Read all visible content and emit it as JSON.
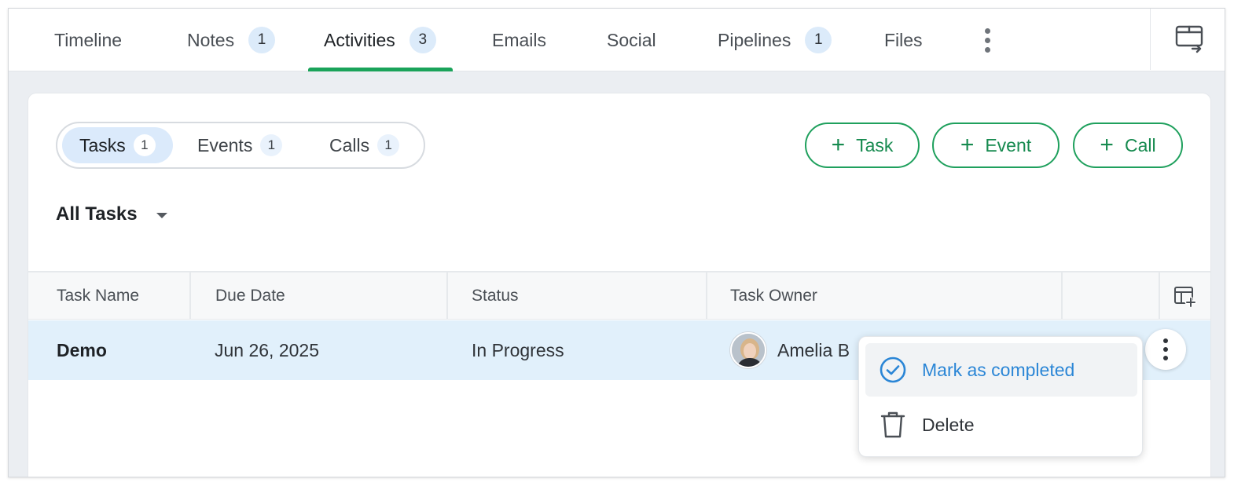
{
  "top_tabs": [
    {
      "label": "Timeline",
      "count": ""
    },
    {
      "label": "Notes",
      "count": "1"
    },
    {
      "label": "Activities",
      "count": "3"
    },
    {
      "label": "Emails",
      "count": ""
    },
    {
      "label": "Social",
      "count": ""
    },
    {
      "label": "Pipelines",
      "count": "1"
    },
    {
      "label": "Files",
      "count": ""
    }
  ],
  "active_tab": "Activities",
  "segments": [
    {
      "label": "Tasks",
      "count": "1"
    },
    {
      "label": "Events",
      "count": "1"
    },
    {
      "label": "Calls",
      "count": "1"
    }
  ],
  "active_segment": "Tasks",
  "add_buttons": {
    "task": "Task",
    "event": "Event",
    "call": "Call"
  },
  "filter": {
    "label": "All Tasks"
  },
  "table": {
    "columns": [
      "Task Name",
      "Due Date",
      "Status",
      "Task Owner"
    ],
    "rows": [
      {
        "name": "Demo",
        "due_date": "Jun 26, 2025",
        "status": "In Progress",
        "owner": "Amelia B"
      }
    ]
  },
  "row_menu": {
    "items": [
      {
        "label": "Mark as completed",
        "icon": "check-circle-icon"
      },
      {
        "label": "Delete",
        "icon": "trash-icon"
      }
    ]
  },
  "colors": {
    "accent_green": "#1fa05d",
    "accent_blue": "#2b86d6",
    "row_highlight": "#e1f0fb",
    "badge_bg": "#dcebfa"
  }
}
